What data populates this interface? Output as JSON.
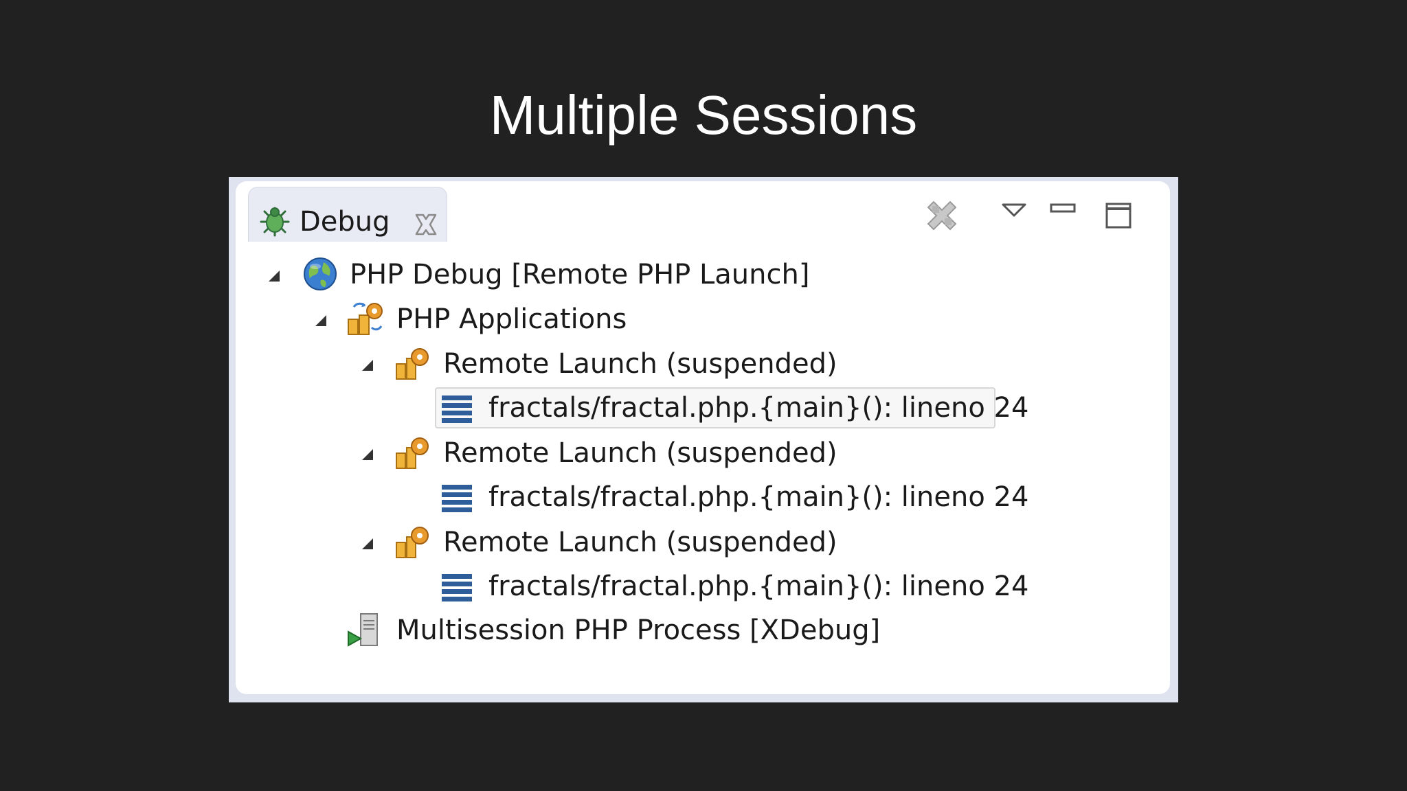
{
  "slide": {
    "title": "Multiple Sessions"
  },
  "view": {
    "tab_label": "Debug",
    "tab_icon": "bug-icon",
    "close_icon": "close-icon"
  },
  "toolbar": {
    "icons": [
      "remove-all-terminated-icon",
      "view-menu-icon",
      "minimize-icon",
      "maximize-icon"
    ]
  },
  "tree": {
    "launch": "PHP Debug [Remote PHP Launch]",
    "applications": "PHP Applications",
    "sessions": [
      {
        "label": "Remote Launch (suspended)",
        "frame": "fractals/fractal.php.{main}(): lineno 24"
      },
      {
        "label": "Remote Launch (suspended)",
        "frame": "fractals/fractal.php.{main}(): lineno 24"
      },
      {
        "label": "Remote Launch (suspended)",
        "frame": "fractals/fractal.php.{main}(): lineno 24"
      }
    ],
    "process": "Multisession PHP Process [XDebug]"
  },
  "colors": {
    "background": "#212121",
    "panel_frame": "#dfe3ef",
    "stack_frame_blue": "#2f5d9a",
    "gear_orange": "#e89a2c"
  }
}
